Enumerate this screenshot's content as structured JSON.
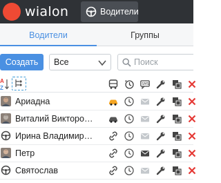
{
  "app": {
    "logo_text": "wialon",
    "module_label": "Водители"
  },
  "tabs": [
    {
      "label": "Водители",
      "active": true
    },
    {
      "label": "Группы",
      "active": false
    }
  ],
  "toolbar": {
    "create_label": "Создать",
    "filter_value": "Все",
    "search_placeholder": "Поиск"
  },
  "drivers": [
    {
      "name": "Ариадна",
      "avatar": "photo",
      "unit_icon": "taxi-car-icon",
      "unit_color": "#f5a623",
      "sms_enabled": false
    },
    {
      "name": "Виталий Викторо…",
      "avatar": "photo",
      "unit_icon": "car-icon",
      "unit_color": "#555555",
      "sms_enabled": false
    },
    {
      "name": "Ирина Владимир…",
      "avatar": "steering-wheel",
      "unit_icon": "bind-icon",
      "unit_color": "#555555",
      "sms_enabled": false
    },
    {
      "name": "Петр",
      "avatar": "photo",
      "unit_icon": "bind-icon",
      "unit_color": "#555555",
      "sms_enabled": true
    },
    {
      "name": "Святослав",
      "avatar": "steering-wheel",
      "unit_icon": "bind-icon",
      "unit_color": "#555555",
      "sms_enabled": false
    }
  ],
  "colors": {
    "accent": "#4a90e2",
    "topbar": "#2f3236",
    "logo": "#ef4a34",
    "delete": "#e53935"
  }
}
